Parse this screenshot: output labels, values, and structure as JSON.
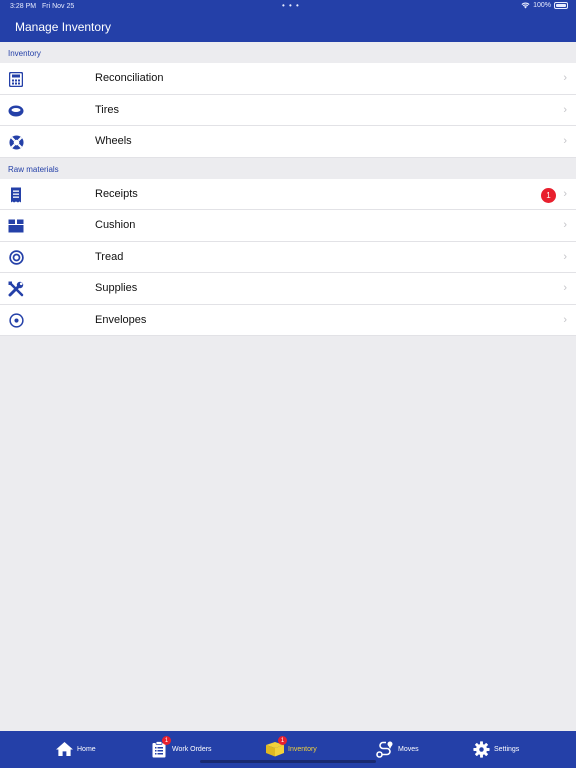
{
  "status_bar": {
    "time": "3:28 PM",
    "date": "Fri Nov 25",
    "dots": "• • •",
    "battery_text": "100%"
  },
  "header": {
    "title": "Manage Inventory"
  },
  "sections": [
    {
      "title": "Inventory",
      "items": [
        {
          "label": "Reconciliation",
          "icon": "calculator-icon"
        },
        {
          "label": "Tires",
          "icon": "tire-icon"
        },
        {
          "label": "Wheels",
          "icon": "wheel-icon"
        }
      ]
    },
    {
      "title": "Raw materials",
      "items": [
        {
          "label": "Receipts",
          "icon": "receipt-icon",
          "badge": "1"
        },
        {
          "label": "Cushion",
          "icon": "box-icon"
        },
        {
          "label": "Tread",
          "icon": "target-icon"
        },
        {
          "label": "Supplies",
          "icon": "tools-icon"
        },
        {
          "label": "Envelopes",
          "icon": "dot-circle-icon"
        }
      ]
    }
  ],
  "chevron": "›",
  "tab_bar": {
    "tabs": [
      {
        "label": "Home",
        "icon": "home-icon",
        "active": false
      },
      {
        "label": "Work Orders",
        "icon": "clipboard-icon",
        "badge": "1",
        "active": false
      },
      {
        "label": "Inventory",
        "icon": "inventory-box-icon",
        "badge": "1",
        "active": true
      },
      {
        "label": "Moves",
        "icon": "route-icon",
        "active": false
      },
      {
        "label": "Settings",
        "icon": "gear-icon",
        "active": false
      }
    ]
  },
  "colors": {
    "brand_blue": "#2440a8",
    "active_tab": "#f3d23a",
    "badge_red": "#e8202e",
    "background": "#ececef"
  }
}
